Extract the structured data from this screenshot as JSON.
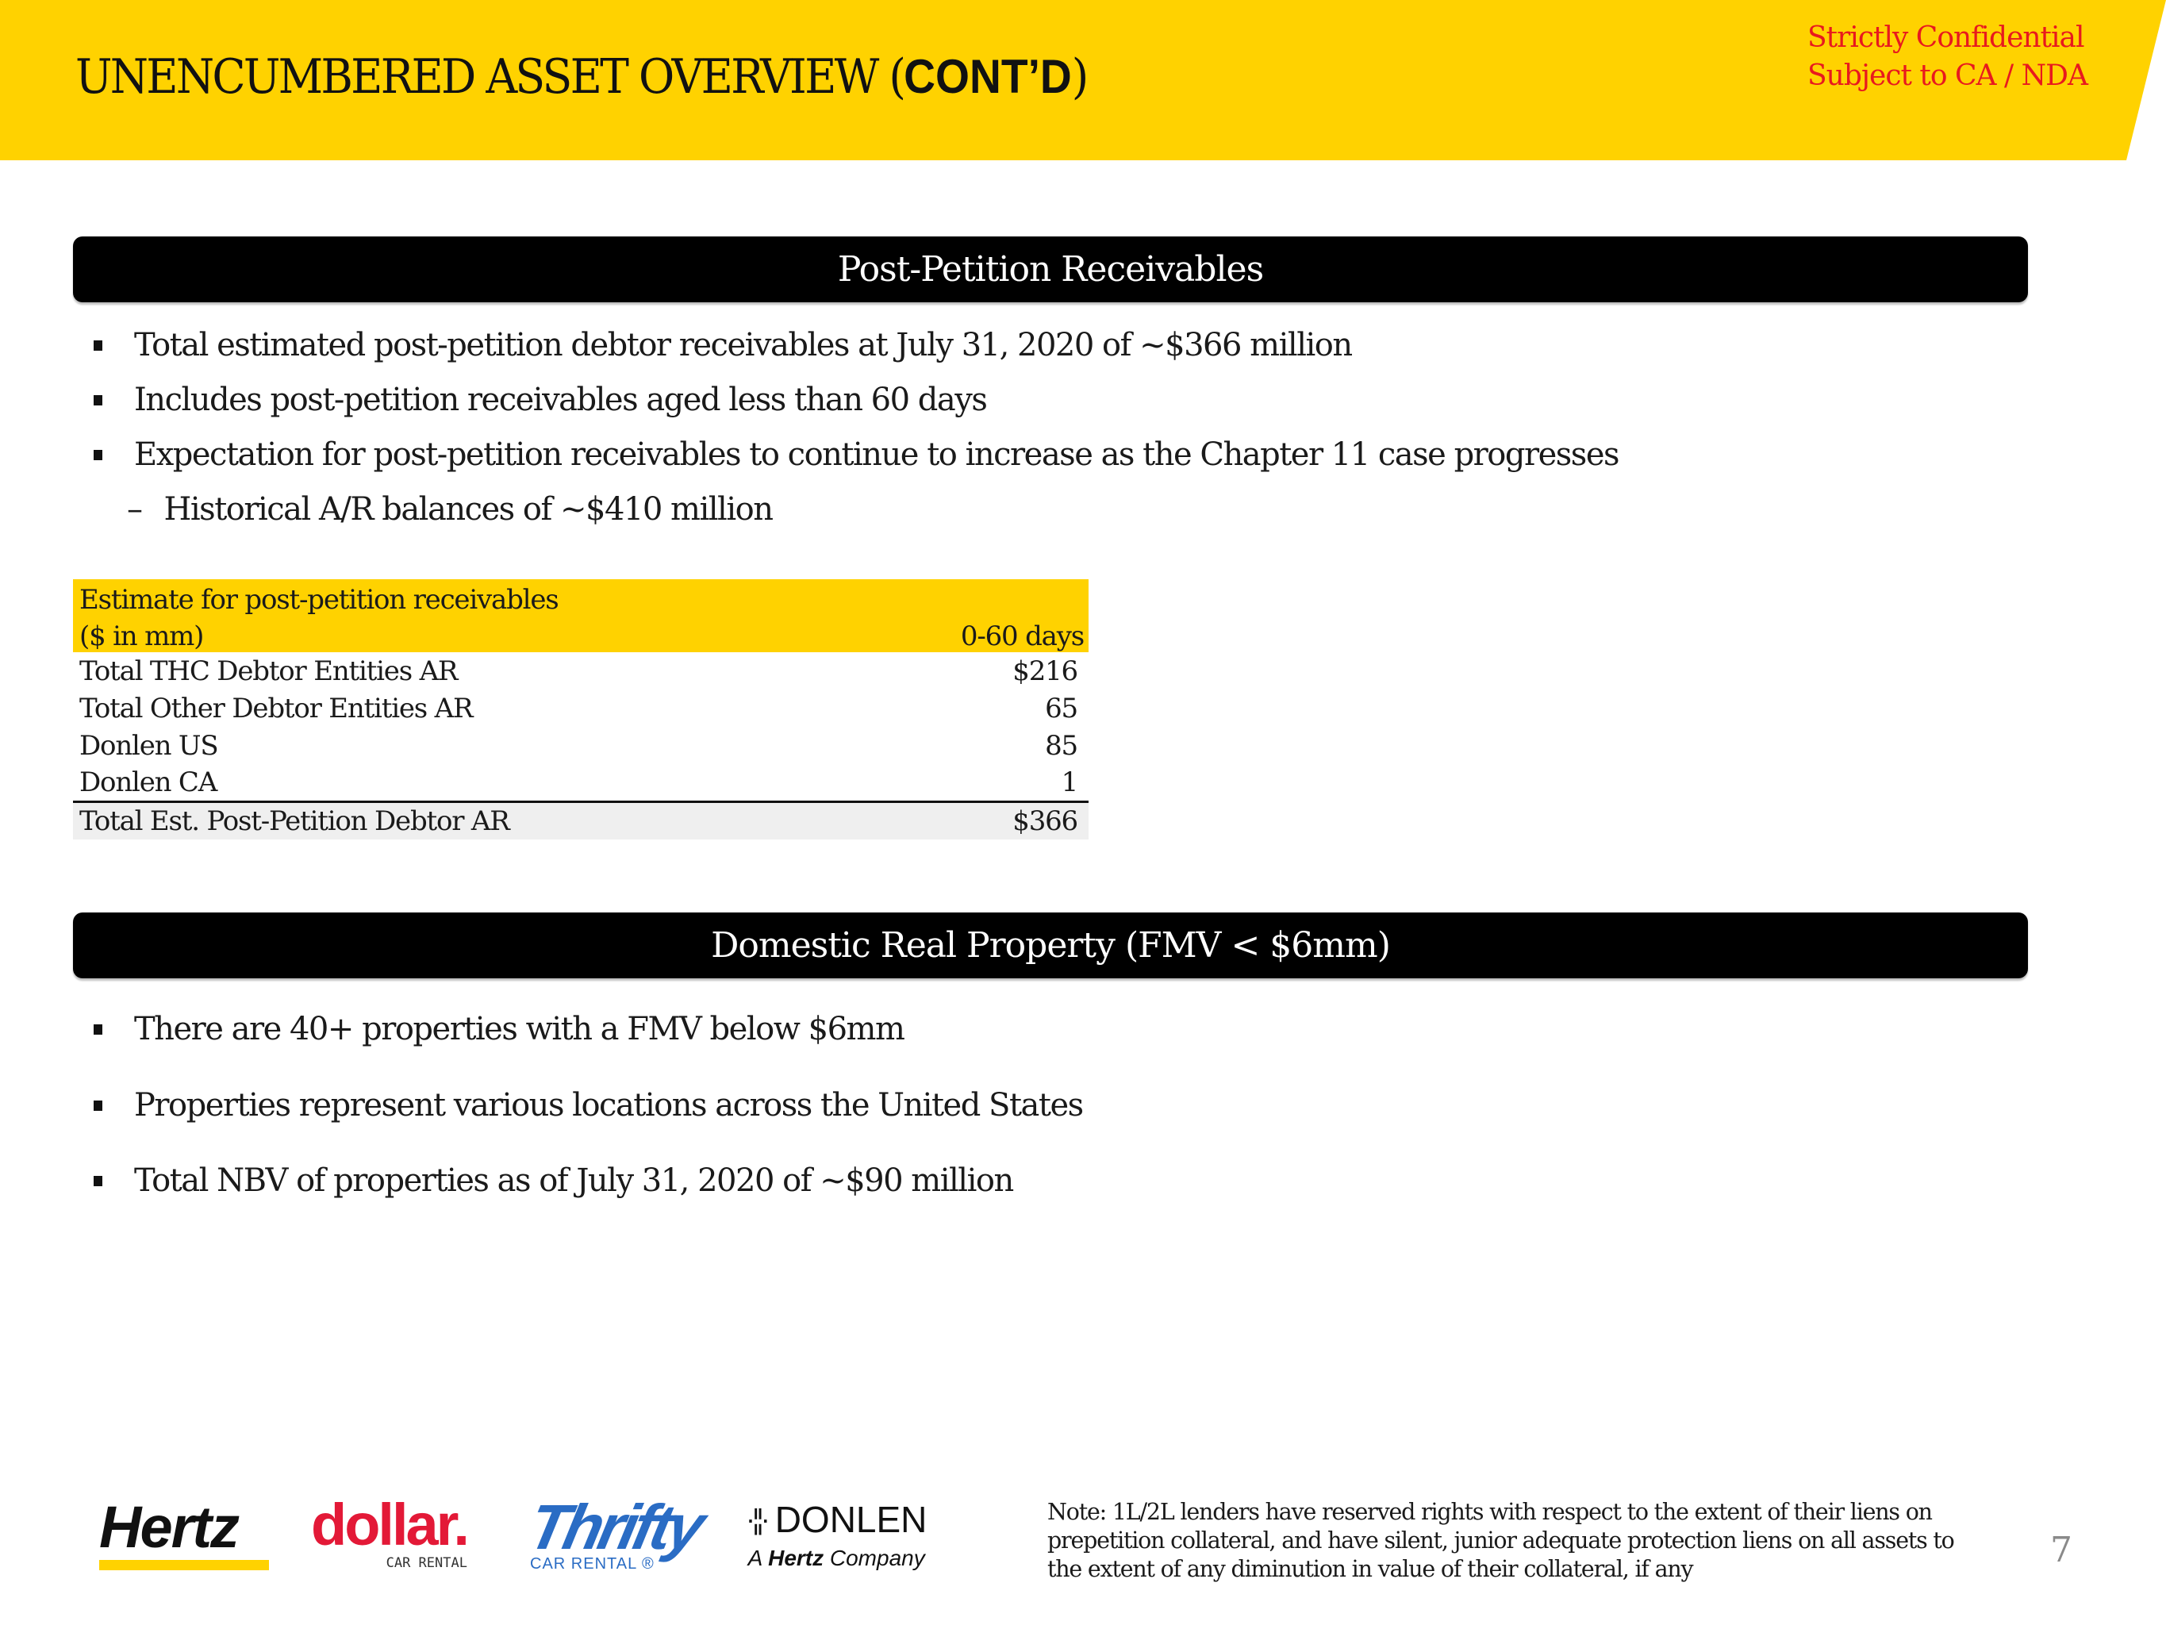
{
  "header": {
    "title_regular": "UNENCUMBERED ASSET OVERVIEW (",
    "title_bold": "CONT’D",
    "title_close": ")",
    "confidential_line1": "Strictly Confidential",
    "confidential_line2": "Subject to CA / NDA",
    "accent_color": "#FFD200",
    "confidential_color": "#E8191E"
  },
  "sections": {
    "receivables": {
      "banner": "Post-Petition Receivables",
      "bullets": [
        "Total estimated post-petition debtor receivables at July 31, 2020 of ~$366 million",
        "Includes post-petition receivables aged less than 60 days",
        "Expectation for post-petition receivables to continue to increase as the Chapter 11 case progresses"
      ],
      "sub_bullet": "Historical A/R balances of ~$410 million",
      "sub_bullet_marker": "–",
      "table": {
        "header_line1": "Estimate for post-petition receivables",
        "header_line2": "($ in mm)",
        "column": "0-60 days",
        "rows": [
          {
            "label": "Total THC Debtor Entities AR",
            "value": "$216"
          },
          {
            "label": "Total Other Debtor Entities AR",
            "value": "65"
          },
          {
            "label": "Donlen US",
            "value": "85"
          },
          {
            "label": "Donlen CA",
            "value": "1"
          }
        ],
        "total": {
          "label": "Total Est. Post-Petition Debtor AR",
          "value": "$366"
        }
      }
    },
    "property": {
      "banner": "Domestic Real Property (FMV < $6mm)",
      "bullets": [
        "There are 40+ properties with a FMV below $6mm",
        "Properties represent various locations across the United States",
        "Total NBV of properties as of July 31, 2020 of ~$90 million"
      ]
    }
  },
  "footer": {
    "logos": {
      "hertz": "Hertz",
      "dollar": "dollar.",
      "dollar_sub": "CAR RENTAL",
      "thrifty": "Thrifty",
      "thrifty_sub": "CAR RENTAL ®",
      "donlen": "DONLEN",
      "donlen_glyph": "·¦¦·",
      "donlen_sub_a": "A ",
      "donlen_sub_hertz": "Hertz",
      "donlen_sub_company": " Company"
    },
    "note": "Note: 1L/2L lenders have reserved rights with respect to the extent of their liens on prepetition collateral, and have silent, junior adequate protection liens on all assets to the extent of any diminution in value of their collateral, if any",
    "page_number": "7"
  }
}
